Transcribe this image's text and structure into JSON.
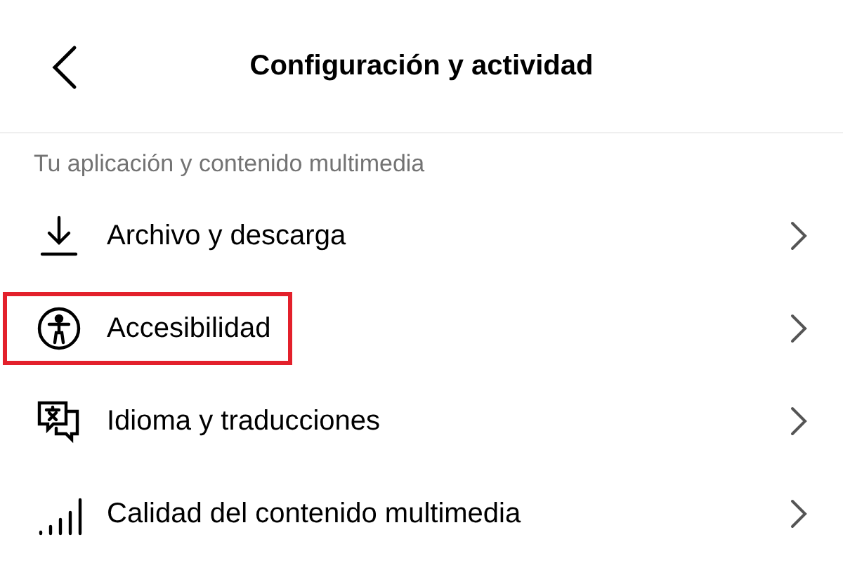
{
  "header": {
    "title": "Configuración y actividad"
  },
  "section": {
    "title": "Tu aplicación y contenido multimedia"
  },
  "items": [
    {
      "kind": "download",
      "label": "Archivo y descarga",
      "highlighted": false
    },
    {
      "kind": "accessibility",
      "label": "Accesibilidad",
      "highlighted": true
    },
    {
      "kind": "language",
      "label": "Idioma y traducciones",
      "highlighted": false
    },
    {
      "kind": "quality",
      "label": "Calidad del contenido multimedia",
      "highlighted": false
    }
  ]
}
